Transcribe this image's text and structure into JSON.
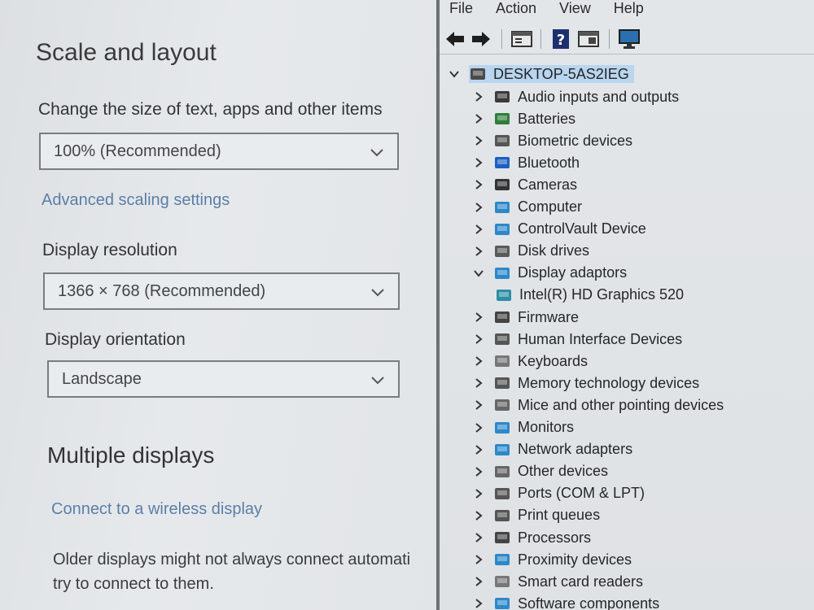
{
  "settings": {
    "title": "Scale and layout",
    "scale_label": "Change the size of text, apps and other items",
    "scale_value": "100% (Recommended)",
    "advanced_link": "Advanced scaling settings",
    "resolution_label": "Display resolution",
    "resolution_value": "1366 × 768 (Recommended)",
    "orientation_label": "Display orientation",
    "orientation_value": "Landscape",
    "multi_title": "Multiple displays",
    "wireless_link": "Connect to a wireless display",
    "note_line1": "Older displays might not always connect automati",
    "note_line2": "try to connect to them."
  },
  "devmgr": {
    "menu": [
      "File",
      "Action",
      "View",
      "Help"
    ],
    "toolbar_icons": [
      "back-arrow-icon",
      "forward-arrow-icon",
      "properties-icon",
      "help-icon",
      "show-hidden-icon",
      "monitor-icon"
    ],
    "root": "DESKTOP-5AS2IEG",
    "categories": [
      {
        "label": "Audio inputs and outputs",
        "icon": "speaker-icon",
        "color": "#3a3a3a",
        "expanded": false
      },
      {
        "label": "Batteries",
        "icon": "battery-icon",
        "color": "#2f7d3a",
        "expanded": false
      },
      {
        "label": "Biometric devices",
        "icon": "fingerprint-icon",
        "color": "#555555",
        "expanded": false
      },
      {
        "label": "Bluetooth",
        "icon": "bluetooth-icon",
        "color": "#1b5fc2",
        "expanded": false
      },
      {
        "label": "Cameras",
        "icon": "camera-icon",
        "color": "#333333",
        "expanded": false
      },
      {
        "label": "Computer",
        "icon": "computer-icon",
        "color": "#2d88c9",
        "expanded": false
      },
      {
        "label": "ControlVault Device",
        "icon": "controlvault-icon",
        "color": "#2d88c9",
        "expanded": false
      },
      {
        "label": "Disk drives",
        "icon": "disk-drive-icon",
        "color": "#5a5a5a",
        "expanded": false
      },
      {
        "label": "Display adaptors",
        "icon": "display-adapter-icon",
        "color": "#2d88c9",
        "expanded": true
      },
      {
        "label": "Intel(R) HD Graphics 520",
        "icon": "display-adapter-icon",
        "color": "#2d8ea5",
        "child": true
      },
      {
        "label": "Firmware",
        "icon": "firmware-icon",
        "color": "#444444",
        "expanded": false
      },
      {
        "label": "Human Interface Devices",
        "icon": "hid-icon",
        "color": "#555555",
        "expanded": false
      },
      {
        "label": "Keyboards",
        "icon": "keyboard-icon",
        "color": "#777777",
        "expanded": false
      },
      {
        "label": "Memory technology devices",
        "icon": "memory-icon",
        "color": "#555555",
        "expanded": false
      },
      {
        "label": "Mice and other pointing devices",
        "icon": "mouse-icon",
        "color": "#666666",
        "expanded": false
      },
      {
        "label": "Monitors",
        "icon": "monitor-icon",
        "color": "#2d88c9",
        "expanded": false
      },
      {
        "label": "Network adapters",
        "icon": "network-icon",
        "color": "#2d88c9",
        "expanded": false
      },
      {
        "label": "Other devices",
        "icon": "other-devices-icon",
        "color": "#666666",
        "expanded": false
      },
      {
        "label": "Ports (COM & LPT)",
        "icon": "port-icon",
        "color": "#555555",
        "expanded": false
      },
      {
        "label": "Print queues",
        "icon": "printer-icon",
        "color": "#555555",
        "expanded": false
      },
      {
        "label": "Processors",
        "icon": "processor-icon",
        "color": "#444444",
        "expanded": false
      },
      {
        "label": "Proximity devices",
        "icon": "proximity-icon",
        "color": "#2d88c9",
        "expanded": false
      },
      {
        "label": "Smart card readers",
        "icon": "smart-card-icon",
        "color": "#777777",
        "expanded": false
      },
      {
        "label": "Software components",
        "icon": "software-icon",
        "color": "#2d88c9",
        "expanded": false
      }
    ]
  }
}
